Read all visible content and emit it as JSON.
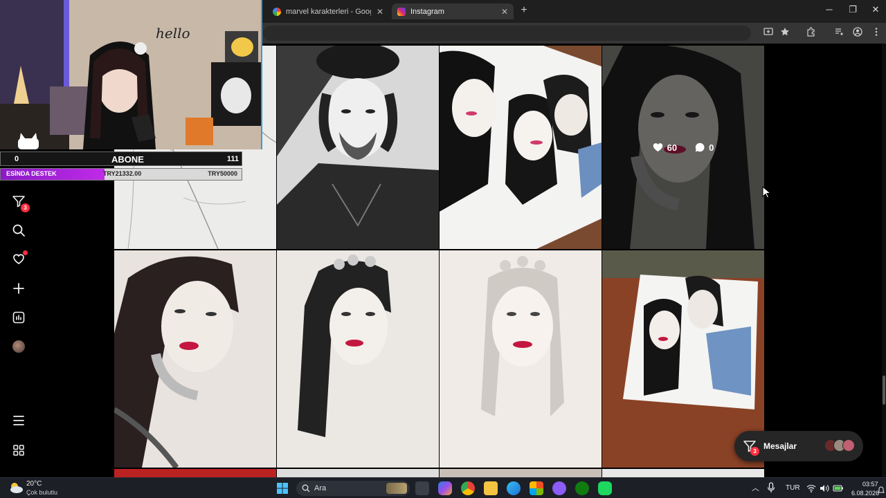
{
  "browser": {
    "tabs": [
      {
        "title": "marvel karakterleri - Google'da",
        "close": "✕",
        "active": false
      },
      {
        "title": "Instagram",
        "close": "✕",
        "active": true
      }
    ],
    "new_tab": "+",
    "window_controls": {
      "minimize": "─",
      "restore": "❐",
      "close": "✕"
    }
  },
  "instagram": {
    "sidebar": {
      "notifications_count": "3"
    },
    "hover_overlay": {
      "likes": "60",
      "comments": "0"
    },
    "messages": {
      "label": "Mesajlar",
      "badge": "3"
    }
  },
  "stream_overlay": {
    "subscriber_count_left": "0",
    "subscriber_label": "ABONE",
    "subscriber_goal": "111",
    "donation_label": "ESİNDA DESTEK",
    "donation_current": "TRY21332.00",
    "donation_goal": "TRY50000",
    "donation_progress": 0.43,
    "wall_text": "hello"
  },
  "taskbar": {
    "weather_temp": "20°C",
    "weather_desc": "Çok bulutlu",
    "search_placeholder": "Ara",
    "language": "TUR",
    "time": "03:57",
    "date": "6.08.2026"
  },
  "colors": {
    "accent_purple": "#c02be8",
    "ig_red": "#ff3040",
    "browser_bg": "#1f1f1f"
  }
}
